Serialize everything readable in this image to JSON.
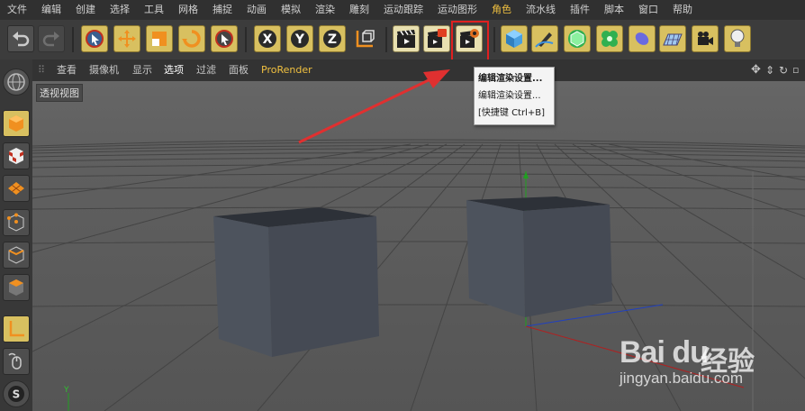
{
  "menu": {
    "items": [
      "文件",
      "编辑",
      "创建",
      "选择",
      "工具",
      "网格",
      "捕捉",
      "动画",
      "模拟",
      "渲染",
      "雕刻",
      "运动跟踪",
      "运动图形",
      "角色",
      "流水线",
      "插件",
      "脚本",
      "窗口",
      "帮助"
    ],
    "highlight_index": 13
  },
  "viewport_menu": {
    "items": [
      "查看",
      "摄像机",
      "显示",
      "选项",
      "过滤",
      "面板"
    ],
    "selected_index": 3,
    "prorender": "ProRender",
    "view_label": "透视视图"
  },
  "tooltip": {
    "title": "编辑渲染设置...",
    "description": "编辑渲染设置...",
    "shortcut": "[快捷键 Ctrl+B]"
  },
  "axis": {
    "y": "Y"
  },
  "watermark": {
    "brand": "Bai du",
    "cn": "经验",
    "url": "jingyan.baidu.com"
  },
  "colors": {
    "highlight_box": "#e02020",
    "arrow": "#e03030",
    "accent": "#f0c040"
  }
}
